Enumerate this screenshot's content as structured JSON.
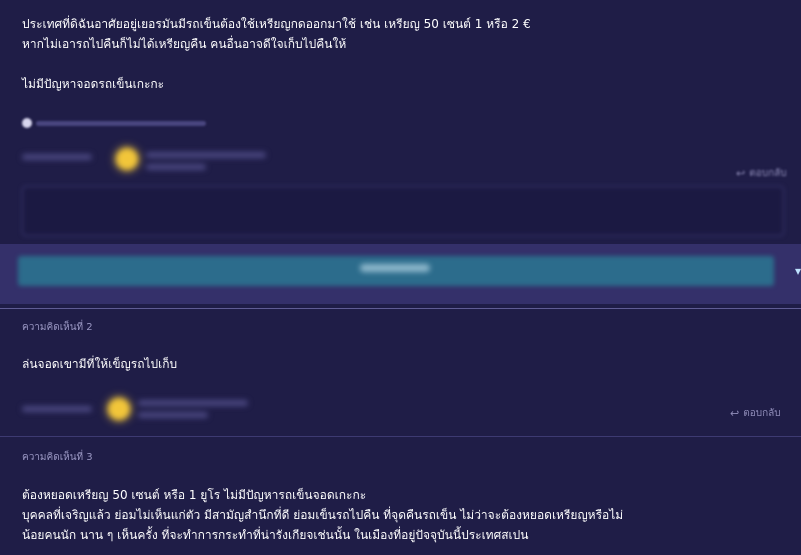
{
  "comment1": {
    "lines": [
      "ประเทศที่ดิฉันอาศัยอยู่เยอรมันมีรถเข็นต้องใช้เหรียญกดออกมาใช้ เช่น เหรียญ 50 เซนต์ 1 หรือ 2 €",
      "หากไม่เอารถไปคืนก็ไม่ได้เหรียญคืน คนอื่นอาจดีใจเก็บไปคืนให้",
      "ไม่มีปัญหาจอดรถเข็นเกะกะ"
    ],
    "reply_label": "ตอบกลับ"
  },
  "comment2": {
    "label": "ความคิดเห็นที่ 2",
    "text": "ล่นจอดเขามีที่ให้เข็ญรถไปเก็บ",
    "reply_label": "ตอบกลับ"
  },
  "comment3": {
    "label": "ความคิดเห็นที่ 3",
    "lines": [
      "ต้องหยอดเหรียญ 50 เซนต์  หรือ 1 ยูโร   ไม่มีปัญหารถเข็นจอดเกะกะ",
      "บุคคลที่เจริญแล้ว  ย่อมไม่เห็นแก่ตัว มีสามัญสำนึกที่ดี ย่อมเข็นรถไปคืน ที่จุดคืนรถเข็น ไม่ว่าจะต้องหยอดเหรียญหรือไม่",
      "น้อยคนนัก  นาน ๆ เห็นครั้ง ที่จะทำการกระทำที่น่ารังเกียจเช่นนั้น ในเมืองที่อยู่ปัจจุบันนี้ประเทศสเปน"
    ]
  },
  "colors": {
    "background": "#1f1d47",
    "submit_button": "#2c6c8c",
    "avatar": "#f2c63a"
  }
}
